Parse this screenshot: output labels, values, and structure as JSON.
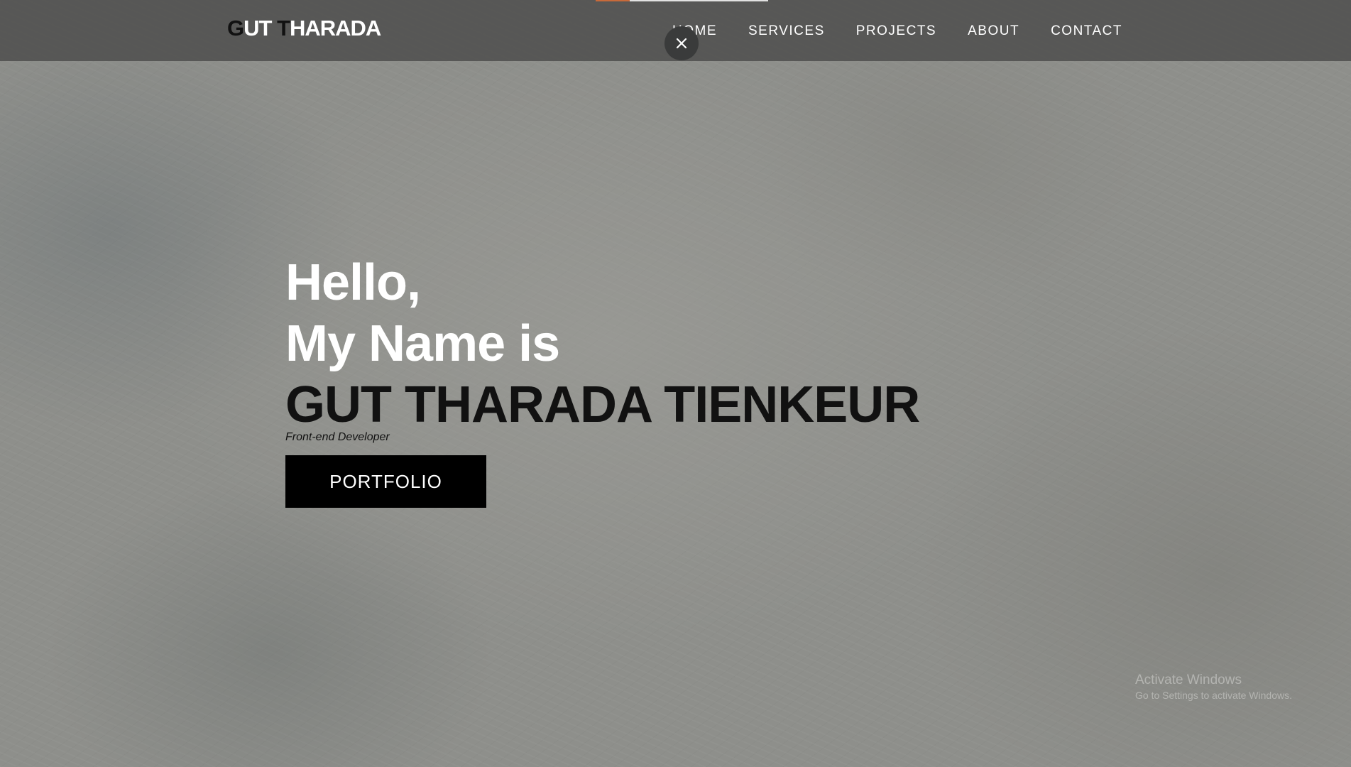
{
  "navbar": {
    "brand": {
      "dark_g": "G",
      "white_ut": "UT ",
      "dark_t": "T",
      "white_harada": "HARADA"
    },
    "links": [
      "HOME",
      "SERVICES",
      "PROJECTS",
      "ABOUT",
      "CONTACT"
    ],
    "close_icon": "close-icon"
  },
  "hero": {
    "line1": "Hello,",
    "line2": "My Name is",
    "name": "GUT THARADA TIENKEUR",
    "subtitle": "Front-end Developer",
    "button_label": "PORTFOLIO"
  },
  "watermark": {
    "title": "Activate Windows",
    "subtitle": "Go to Settings to activate Windows."
  },
  "colors": {
    "nav_bg": "#50504e",
    "button_bg": "#000000",
    "accent": "#c86a3a"
  }
}
